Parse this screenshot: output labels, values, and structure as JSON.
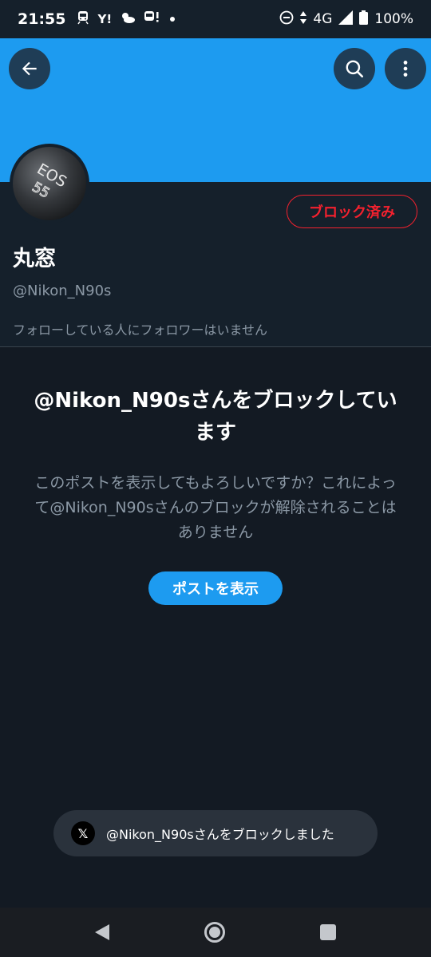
{
  "status_bar": {
    "time": "21:55",
    "yahoo": "Y!",
    "network": "4G",
    "battery": "100%"
  },
  "profile": {
    "display_name": "丸窓",
    "handle": "@Nikon_N90s",
    "avatar_text_top": "EOS",
    "avatar_text_bottom": "55",
    "blocked_label": "ブロック済み",
    "followers_note": "フォローしている人にフォロワーはいません"
  },
  "block_notice": {
    "title": "@Nikon_N90sさんをブロックしています",
    "description": "このポストを表示してもよろしいですか？これによって@Nikon_N90sさんのブロックが解除されることはありません",
    "show_post_label": "ポストを表示"
  },
  "toast": {
    "message": "@Nikon_N90sさんをブロックしました",
    "logo": "𝕏"
  },
  "colors": {
    "banner": "#1d9bf0",
    "background": "#15202b",
    "blocked": "#f4212e",
    "accent": "#1d9bf0"
  },
  "icons": [
    "back-arrow-icon",
    "search-icon",
    "more-vertical-icon",
    "x-logo-icon"
  ]
}
